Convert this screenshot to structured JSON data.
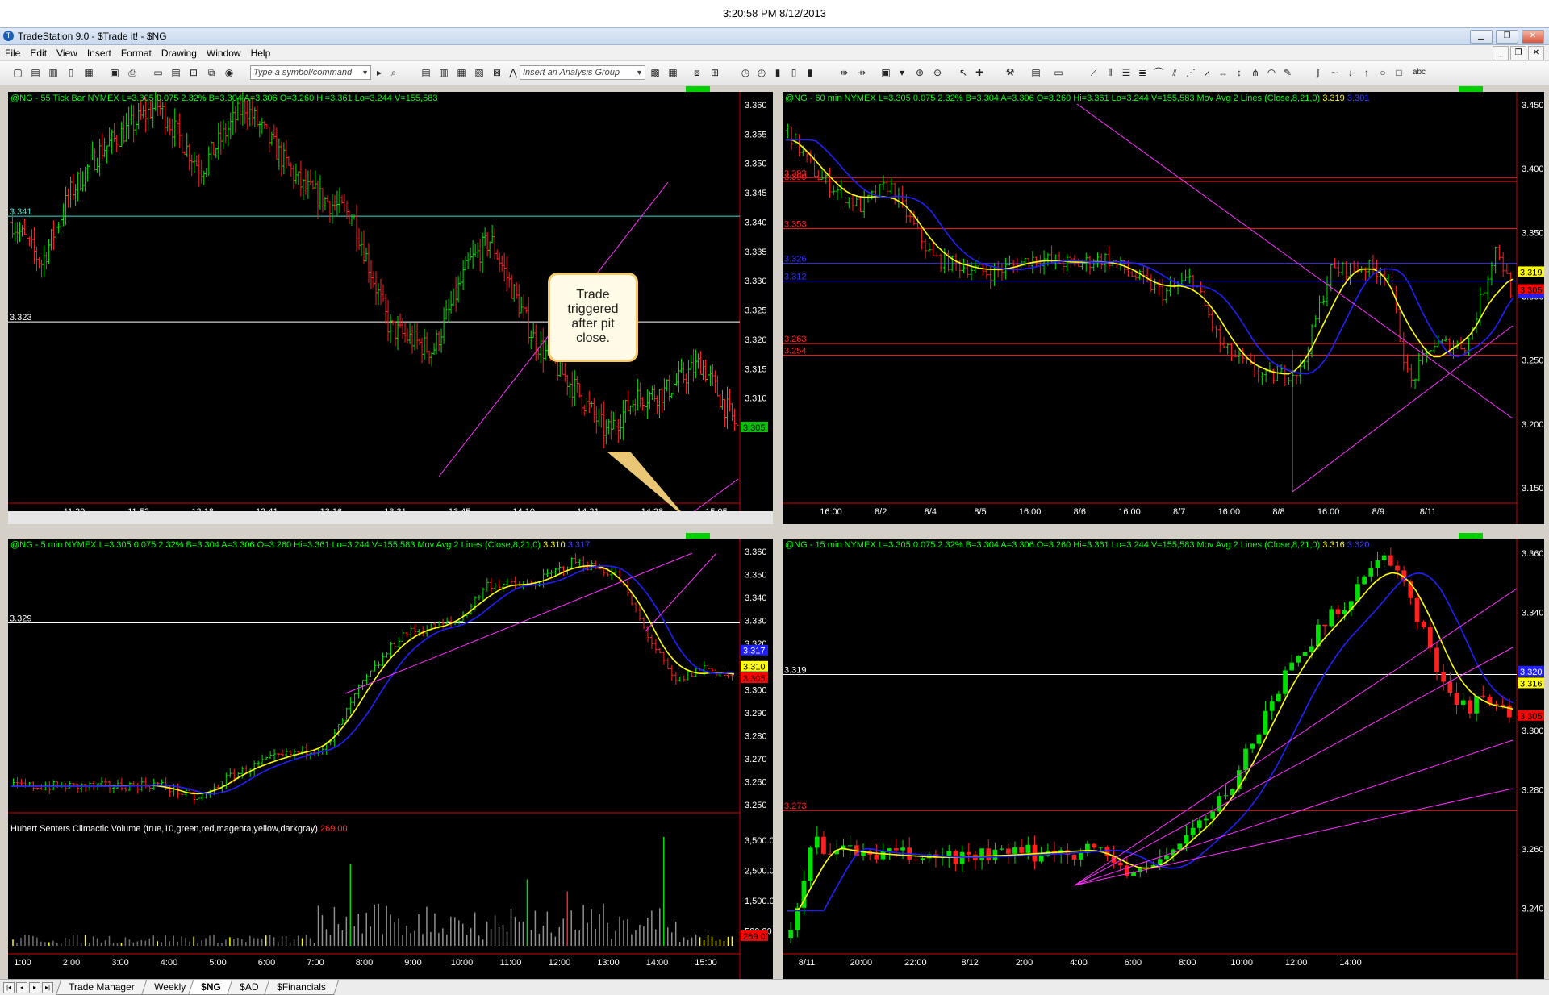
{
  "clock": "3:20:58 PM 8/12/2013",
  "window": {
    "title": "TradeStation 9.0 - $Trade it! - $NG"
  },
  "menu": [
    "File",
    "Edit",
    "View",
    "Insert",
    "Format",
    "Drawing",
    "Window",
    "Help"
  ],
  "toolbar": {
    "symbol_placeholder": "Type a symbol/command",
    "analysis_placeholder": "Insert an Analysis Group"
  },
  "callout": {
    "lines": [
      "Trade",
      "triggered",
      "after pit",
      "close."
    ]
  },
  "colors": {
    "up": "#00e000",
    "down": "#ff2020",
    "fast_ma": "#ffff00",
    "slow_ma": "#2020ff",
    "trendline": "#ff30ff",
    "bg": "#000000"
  },
  "tabs": [
    "Trade Manager",
    "Weekly",
    "$NG",
    "$AD",
    "$Financials"
  ],
  "active_tab": "$NG",
  "charts": {
    "tick": {
      "header": "@NG - 55 Tick Bar  NYMEX  L=3.305  0.075  2.32%  B=3.304  A=3.306  O=3.260  Hi=3.361  Lo=3.244  V=155,583",
      "y_ticks": [
        "3.360",
        "3.355",
        "3.350",
        "3.345",
        "3.340",
        "3.335",
        "3.330",
        "3.325",
        "3.320",
        "3.315",
        "3.310"
      ],
      "x_ticks": [
        "11:29",
        "11:52",
        "12:18",
        "12:41",
        "13:16",
        "13:31",
        "13:45",
        "14:10",
        "14:21",
        "14:28",
        "15:05"
      ],
      "levels": [
        "3.341",
        "3.323"
      ],
      "last": "3.305"
    },
    "h60": {
      "header": "@NG - 60 min  NYMEX  L=3.305  0.075  2.32%  B=3.304  A=3.306  O=3.260  Hi=3.361  Lo=3.244  V=155,583  Mov Avg 2 Lines (Close,8,21,0)",
      "ma_fast": "3.319",
      "ma_slow": "3.301",
      "y_ticks": [
        "3.450",
        "3.400",
        "3.350",
        "3.300",
        "3.250",
        "3.200",
        "3.150"
      ],
      "x_ticks": [
        "16:00",
        "8/2",
        "8/4",
        "8/5",
        "16:00",
        "8/6",
        "16:00",
        "8/7",
        "16:00",
        "8/8",
        "16:00",
        "8/9",
        "8/11"
      ],
      "levels": [
        "3.393",
        "3.390",
        "3.353",
        "3.326",
        "3.312",
        "3.263",
        "3.254"
      ],
      "last_fast": "3.319",
      "last": "3.305"
    },
    "m5": {
      "header": "@NG - 5 min  NYMEX  L=3.305  0.075  2.32%  B=3.304  A=3.306  O=3.260  Hi=3.361  Lo=3.244  V=155,583  Mov Avg 2 Lines (Close,8,21,0)",
      "ma_fast": "3.310",
      "ma_slow": "3.317",
      "y_ticks": [
        "3.360",
        "3.350",
        "3.340",
        "3.330",
        "3.320",
        "3.310",
        "3.300",
        "3.290",
        "3.280",
        "3.270",
        "3.260",
        "3.250"
      ],
      "x_ticks": [
        "1:00",
        "2:00",
        "3:00",
        "4:00",
        "5:00",
        "6:00",
        "7:00",
        "8:00",
        "9:00",
        "10:00",
        "11:00",
        "12:00",
        "13:00",
        "14:00",
        "15:00"
      ],
      "levels": [
        "3.329"
      ],
      "last_slow": "3.317",
      "last_fast": "3.310",
      "last": "3.305",
      "volume": {
        "header": "Hubert Senters Climactic Volume (true,10,green,red,magenta,yellow,darkgray)",
        "value": "269.00",
        "y_ticks": [
          "3,500.00",
          "2,500.00",
          "1,500.00",
          "500.00"
        ],
        "last": "269.00"
      }
    },
    "m15": {
      "header": "@NG - 15 min  NYMEX  L=3.305  0.075  2.32%  B=3.304  A=3.306  O=3.260  Hi=3.361  Lo=3.244  V=155,583  Mov Avg 2 Lines (Close,8,21,0)",
      "ma_fast": "3.316",
      "ma_slow": "3.320",
      "y_ticks": [
        "3.360",
        "3.340",
        "3.320",
        "3.300",
        "3.280",
        "3.260",
        "3.240"
      ],
      "x_ticks": [
        "8/11",
        "20:00",
        "22:00",
        "8/12",
        "2:00",
        "4:00",
        "6:00",
        "8:00",
        "10:00",
        "12:00",
        "14:00"
      ],
      "levels": [
        "3.319",
        "3.273"
      ],
      "last_slow": "3.320",
      "last_fast": "3.316",
      "last": "3.305"
    }
  }
}
